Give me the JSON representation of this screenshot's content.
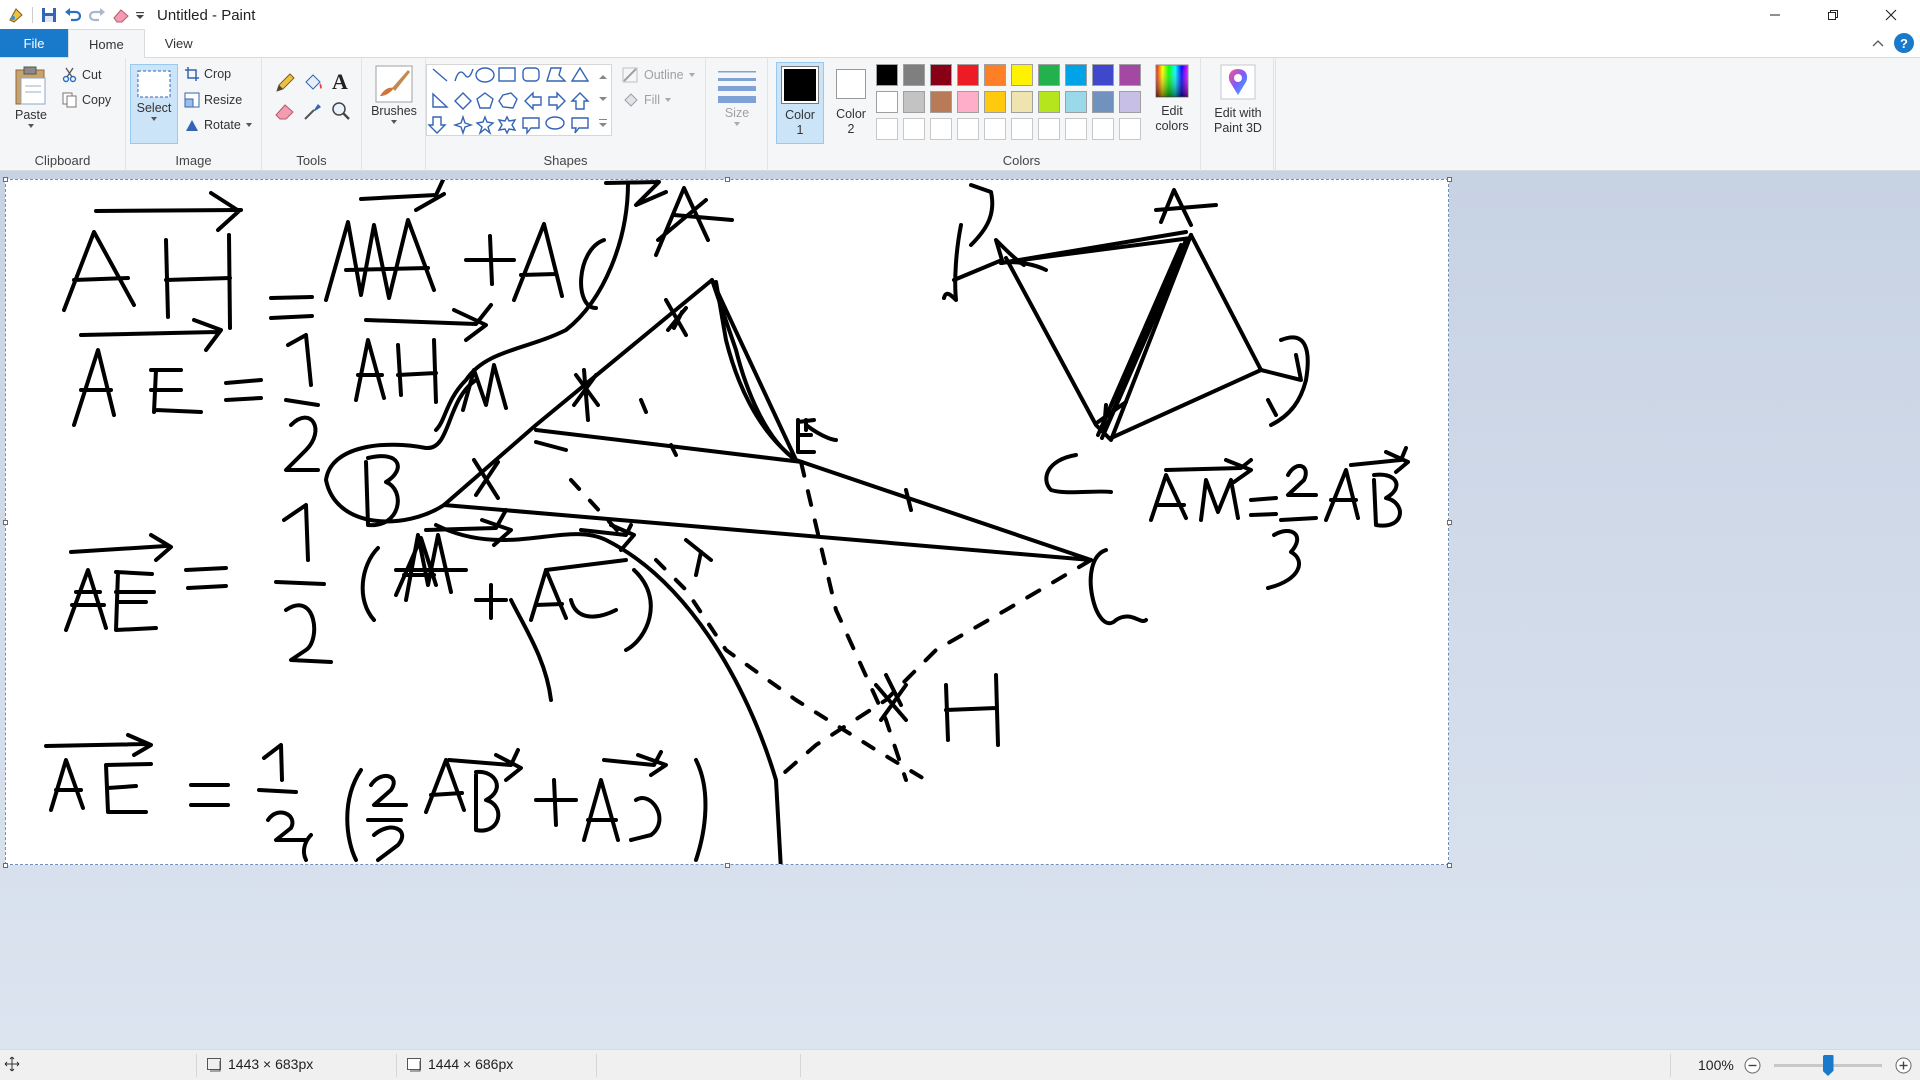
{
  "window": {
    "title": "Untitled - Paint"
  },
  "tabs": [
    {
      "label": "File"
    },
    {
      "label": "Home"
    },
    {
      "label": "View"
    }
  ],
  "ribbon": {
    "clipboard": {
      "label": "Clipboard",
      "paste": "Paste",
      "cut": "Cut",
      "copy": "Copy"
    },
    "image": {
      "label": "Image",
      "select": "Select",
      "crop": "Crop",
      "resize": "Resize",
      "rotate": "Rotate"
    },
    "tools": {
      "label": "Tools"
    },
    "brushes": {
      "label": "Brushes"
    },
    "shapes": {
      "label": "Shapes",
      "outline": "Outline",
      "fill": "Fill"
    },
    "size": {
      "label": "Size"
    },
    "colors": {
      "label": "Colors",
      "color1_line1": "Color",
      "color1_line2": "1",
      "color2_line1": "Color",
      "color2_line2": "2",
      "color1_value": "#000000",
      "color2_value": "#ffffff",
      "edit_colors_line1": "Edit",
      "edit_colors_line2": "colors",
      "palette": [
        "#000000",
        "#7f7f7f",
        "#880015",
        "#ed1c24",
        "#ff7f27",
        "#fff200",
        "#22b14c",
        "#00a2e8",
        "#3f48cc",
        "#a349a4",
        "#ffffff",
        "#c3c3c3",
        "#b97a57",
        "#ffaec9",
        "#ffc90e",
        "#efe4b0",
        "#b5e61d",
        "#99d9ea",
        "#7092be",
        "#c8bfe7",
        "#ffffff",
        "#ffffff",
        "#ffffff",
        "#ffffff",
        "#ffffff",
        "#ffffff",
        "#ffffff",
        "#ffffff",
        "#ffffff",
        "#ffffff"
      ]
    },
    "paint3d": {
      "line1": "Edit with",
      "line2": "Paint 3D"
    }
  },
  "statusbar": {
    "selection_size": "1443 × 683px",
    "image_size": "1444 × 686px",
    "zoom": "100%"
  },
  "zoom_slider_fraction": 0.5
}
